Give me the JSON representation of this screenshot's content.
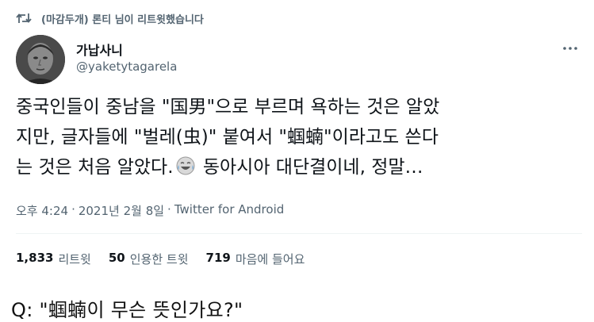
{
  "retweet": {
    "label": "(마감두개) 론티 님이 리트윗했습니다",
    "icon": "retweet-icon"
  },
  "author": {
    "display_name": "가납사니",
    "handle": "@yaketytagarela",
    "avatar_icon": "avatar-portrait"
  },
  "more_icon": "more-dots-icon",
  "tweet": {
    "lines": [
      "중국인들이 중남을 \"国男\"으로 부르며 욕하는 것은 알았",
      "지만, 글자들에 \"벌레(虫)\" 붙여서 \"蝈蝻\"이라고도 쓴다",
      "는 것은 처음 알았다.",
      " 동아시아 대단결이네, 정말…"
    ],
    "emoji": "face-with-tears-of-joy"
  },
  "meta": {
    "time": "오후 4:24",
    "separator": "·",
    "date": "2021년 2월 8일",
    "source": "Twitter for Android"
  },
  "stats": {
    "retweets_count": "1,833",
    "retweets_label": "리트윗",
    "quotes_count": "50",
    "quotes_label": "인용한 트윗",
    "likes_count": "719",
    "likes_label": "마음에 들어요"
  },
  "question": "Q: \"蝈蝻이 무슨 뜻인가요?\""
}
